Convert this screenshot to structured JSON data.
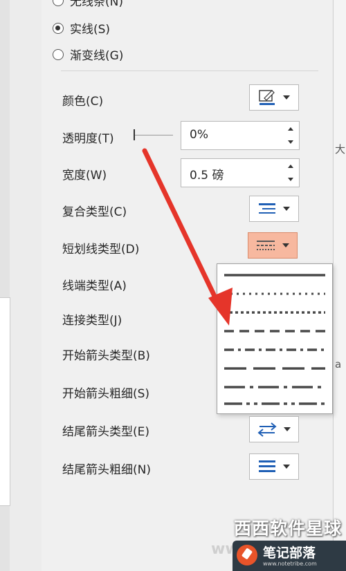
{
  "line_options": [
    {
      "label": "无线条(N)",
      "checked": false
    },
    {
      "label": "实线(S)",
      "checked": true
    },
    {
      "label": "渐变线(G)",
      "checked": false
    }
  ],
  "color": {
    "label": "颜色(C)",
    "icon": "pen-color-icon"
  },
  "transparency": {
    "label": "透明度(T)",
    "value": "0%"
  },
  "width": {
    "label": "宽度(W)",
    "value": "0.5 磅"
  },
  "compound_type": {
    "label": "复合类型(C)",
    "icon": "compound-lines-icon"
  },
  "dash_type": {
    "label": "短划线类型(D)",
    "icon": "dash-type-icon",
    "active": true
  },
  "cap_type": {
    "label": "线端类型(A)"
  },
  "join_type": {
    "label": "连接类型(J)"
  },
  "begin_arrow_type": {
    "label": "开始箭头类型(B)"
  },
  "begin_arrow_size": {
    "label": "开始箭头粗细(S)"
  },
  "end_arrow_type": {
    "label": "结尾箭头类型(E)",
    "icon": "arrow-swap-icon"
  },
  "end_arrow_size": {
    "label": "结尾箭头粗细(N)",
    "icon": "line-weight-icon"
  },
  "dash_menu": {
    "items": [
      "solid",
      "round-dot",
      "square-dot",
      "dash",
      "dash-dot",
      "long-dash",
      "long-dash-dot",
      "long-dash-dot-dot"
    ]
  },
  "right_strip": {
    "glyph1": "大",
    "glyph2": "a"
  },
  "watermark": {
    "brand": "西西软件星球",
    "site_partial": "ww",
    "badge_title": "笔记部落",
    "badge_url": "www.notetribe.com"
  },
  "colors": {
    "accent_arrow": "#e5352a",
    "active_button": "#f7b89f",
    "pen_blue": "#1f5fb5"
  }
}
